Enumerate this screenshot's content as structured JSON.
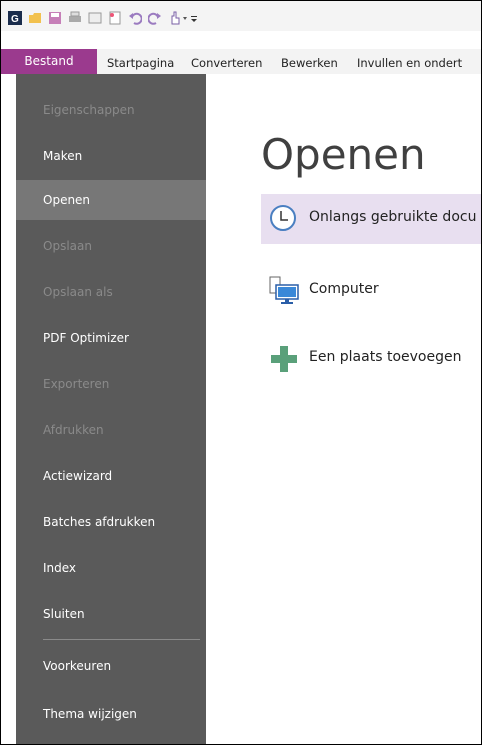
{
  "qat_icons": [
    "app-logo-icon",
    "open-folder-icon",
    "save-icon",
    "print-icon",
    "document-icon",
    "new-document-icon",
    "undo-icon",
    "redo-icon",
    "hand-tool-icon",
    "customize-toolbar-icon"
  ],
  "menubar": {
    "active_tab": "Bestand",
    "tabs": [
      "Startpagina",
      "Converteren",
      "Bewerken",
      "Invullen en ondert"
    ]
  },
  "sidebar": {
    "items": [
      {
        "label": "Eigenschappen",
        "state": "disabled"
      },
      {
        "label": "Maken",
        "state": "enabled"
      },
      {
        "label": "Openen",
        "state": "active"
      },
      {
        "label": "Opslaan",
        "state": "disabled"
      },
      {
        "label": "Opslaan als",
        "state": "disabled"
      },
      {
        "label": "PDF Optimizer",
        "state": "enabled"
      },
      {
        "label": "Exporteren",
        "state": "disabled"
      },
      {
        "label": "Afdrukken",
        "state": "disabled"
      },
      {
        "label": "Actiewizard",
        "state": "enabled"
      },
      {
        "label": "Batches afdrukken",
        "state": "enabled"
      },
      {
        "label": "Index",
        "state": "enabled"
      },
      {
        "label": "Sluiten",
        "state": "enabled"
      }
    ],
    "footer_items": [
      {
        "label": "Voorkeuren"
      },
      {
        "label": "Thema wijzigen"
      }
    ]
  },
  "main": {
    "title": "Openen",
    "options": [
      {
        "label": "Onlangs gebruikte docu",
        "icon": "clock-icon",
        "selected": true
      },
      {
        "label": "Computer",
        "icon": "computer-icon",
        "selected": false
      },
      {
        "label": "Een plaats toevoegen",
        "icon": "plus-icon",
        "selected": false
      }
    ]
  },
  "colors": {
    "accent": "#9b3a8e",
    "sidebar_bg": "#5a5a5a",
    "sidebar_active": "#777777",
    "selected_option_bg": "#e8dff0",
    "plus_icon": "#5aa07a"
  }
}
